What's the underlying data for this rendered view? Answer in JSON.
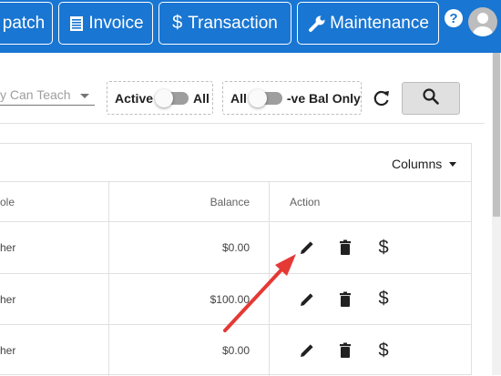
{
  "nav": {
    "dispatch_label": "patch",
    "invoice_label": "Invoice",
    "transaction_label": "Transaction",
    "maintenance_label": "Maintenance",
    "help_label": "?"
  },
  "filters": {
    "can_teach_placeholder": "y Can Teach",
    "active_left": "Active",
    "active_right": "All",
    "balance_left": "All",
    "balance_right": "-ve Bal Only"
  },
  "table": {
    "columns_button": "Columns",
    "headers": {
      "role": "ole",
      "balance": "Balance",
      "action": "Action"
    },
    "rows": [
      {
        "role": "her",
        "balance": "$0.00"
      },
      {
        "role": "her",
        "balance": "$100.00"
      },
      {
        "role": "her",
        "balance": "$0.00"
      }
    ]
  },
  "colors": {
    "accent": "#1976d2",
    "annotation_arrow": "#e53935"
  }
}
